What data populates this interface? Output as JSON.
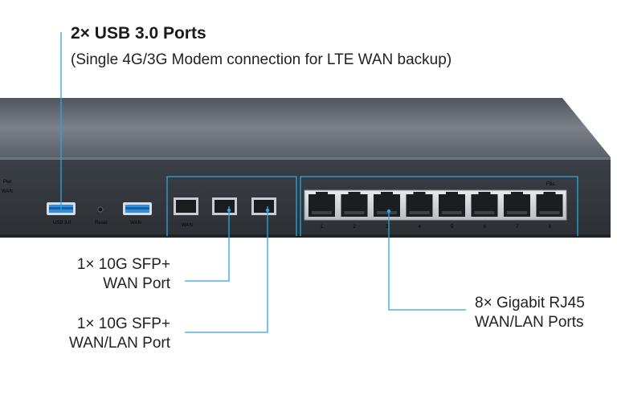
{
  "usb_callout": {
    "title": "2× USB 3.0 Ports",
    "subtitle": "(Single 4G/3G Modem connection for LTE WAN backup)"
  },
  "sfp_wan_callout": {
    "line1": "1× 10G SFP+",
    "line2": "WAN Port"
  },
  "sfp_wanlan_callout": {
    "line1": "1× 10G SFP+",
    "line2": "WAN/LAN Port"
  },
  "rj45_callout": {
    "line1": "8× Gigabit RJ45",
    "line2": "WAN/LAN Ports"
  },
  "panel_labels": {
    "usb": "USB 3.0",
    "reset": "Reset",
    "usb_wan": "WAN",
    "sfp_wan": "WAN",
    "left_pwr": "Pwr",
    "left_wan": "WAN",
    "rj45_group": "FBs"
  },
  "port_numbers": [
    "1",
    "2",
    "3",
    "4",
    "5",
    "6",
    "7",
    "8"
  ],
  "colors": {
    "callout_line": "#29a8e0",
    "chassis": "#3a3f45",
    "usb_blue": "#2f8fe0"
  }
}
